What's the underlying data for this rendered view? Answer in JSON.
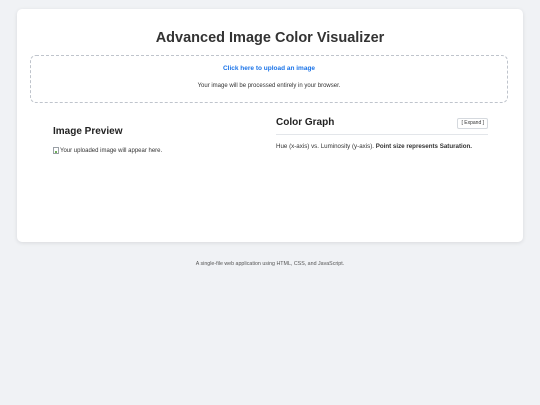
{
  "app": {
    "title": "Advanced Image Color Visualizer"
  },
  "upload": {
    "link_label": "Click here to upload an image",
    "note": "Your image will be processed entirely in your browser."
  },
  "preview": {
    "title": "Image Preview",
    "placeholder_alt": "Your uploaded image will appear here.",
    "icon": "broken-image-icon"
  },
  "graph": {
    "title": "Color Graph",
    "expand_label": "[ Expand ]",
    "desc_prefix": "Hue (x-axis) vs. Luminosity (y-axis).",
    "desc_bold": "Point size represents Saturation."
  },
  "footer": {
    "text": "A single-file web application using HTML, CSS, and JavaScript."
  },
  "colors": {
    "page_background": "#f0f2f5",
    "card_background": "#ffffff",
    "link": "#1a73e8",
    "text": "#333333"
  }
}
